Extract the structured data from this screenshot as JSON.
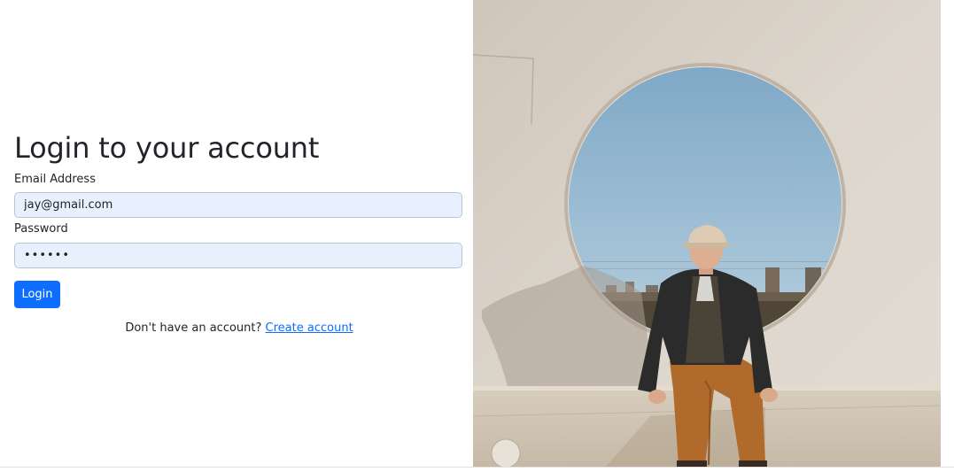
{
  "login": {
    "title": "Login to your account",
    "email_label": "Email Address",
    "email_value": "jay@gmail.com",
    "password_label": "Password",
    "password_value": "••••••",
    "login_button": "Login",
    "signup_prompt": "Don't have an account?",
    "signup_link": "Create account"
  },
  "colors": {
    "primary": "#0d6efd",
    "input_autofill_bg": "#e8f0fe",
    "text": "#212529"
  },
  "photo": {
    "icon": "hero-photo-person-circle-window"
  }
}
